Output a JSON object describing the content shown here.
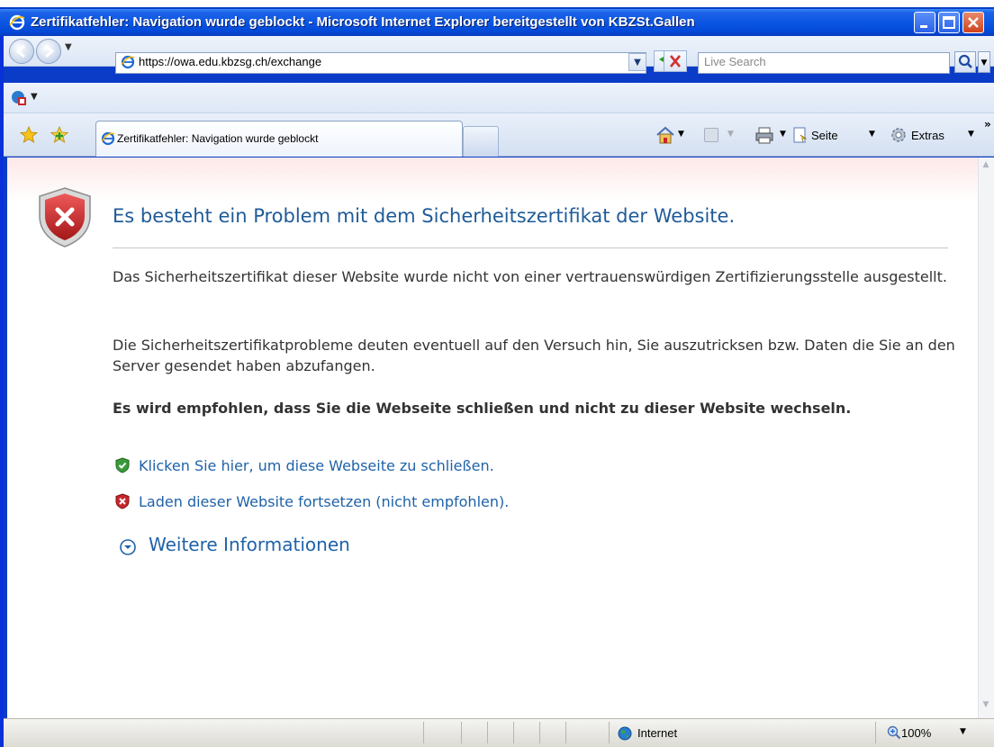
{
  "window": {
    "title": "Zertifikatfehler: Navigation wurde geblockt - Microsoft Internet Explorer bereitgestellt von KBZSt.Gallen"
  },
  "address": {
    "url": "https://owa.edu.kbzsg.ch/exchange",
    "search_placeholder": "Live Search"
  },
  "tabs": [
    {
      "label": "Zertifikatfehler: Navigation wurde geblockt"
    }
  ],
  "toolbar": {
    "page_label": "Seite",
    "tools_label": "Extras"
  },
  "content": {
    "heading": "Es besteht ein Problem mit dem Sicherheitszertifikat der Website.",
    "para1": "Das Sicherheitszertifikat dieser Website wurde nicht von einer vertrauenswürdigen Zertifizierungsstelle ausgestellt.",
    "para2": "Die Sicherheitszertifikatprobleme deuten eventuell auf den Versuch hin, Sie auszutricksen bzw. Daten die Sie an den Server gesendet haben abzufangen.",
    "recommendation": "Es wird empfohlen, dass Sie die Webseite schließen und nicht zu dieser Website wechseln.",
    "link_close": "Klicken Sie hier, um diese Webseite zu schließen.",
    "link_continue": "Laden dieser Website fortsetzen (nicht empfohlen).",
    "more_info": "Weitere Informationen"
  },
  "status": {
    "zone": "Internet",
    "zoom": "100%"
  },
  "colors": {
    "titlebar": "#0a54e2",
    "link": "#1f62a8",
    "heading": "#1f5b98",
    "error_red": "#c8262b"
  },
  "icons": [
    "ie-logo-icon",
    "back-icon",
    "forward-icon",
    "refresh-icon",
    "stop-icon",
    "search-icon",
    "favorites-star-icon",
    "add-favorites-icon",
    "home-icon",
    "feeds-icon",
    "print-icon",
    "page-icon",
    "tools-gear-icon",
    "shield-error-icon",
    "shield-ok-icon",
    "chevron-down-circle-icon",
    "globe-icon",
    "zoom-icon"
  ]
}
